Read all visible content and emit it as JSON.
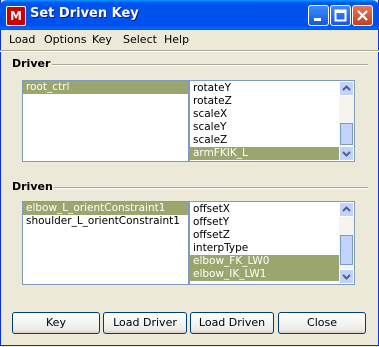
{
  "window": {
    "title": "Set Driven Key",
    "app_icon": "maya-icon"
  },
  "menu": [
    "Load",
    "Options",
    "Key",
    "Select",
    "Help"
  ],
  "driver": {
    "label": "Driver",
    "objects": [
      {
        "label": "root_ctrl",
        "selected": true
      }
    ],
    "attributes": [
      {
        "label": "rotateY",
        "selected": false
      },
      {
        "label": "rotateZ",
        "selected": false
      },
      {
        "label": "scaleX",
        "selected": false
      },
      {
        "label": "scaleY",
        "selected": false
      },
      {
        "label": "scaleZ",
        "selected": false
      },
      {
        "label": "armFKIK_L",
        "selected": true
      }
    ]
  },
  "driven": {
    "label": "Driven",
    "objects": [
      {
        "label": "elbow_L_orientConstraint1",
        "selected": true
      },
      {
        "label": "shoulder_L_orientConstraint1",
        "selected": false
      }
    ],
    "attributes": [
      {
        "label": "offsetX",
        "selected": false
      },
      {
        "label": "offsetY",
        "selected": false
      },
      {
        "label": "offsetZ",
        "selected": false
      },
      {
        "label": "interpType",
        "selected": false
      },
      {
        "label": "elbow_FK_LW0",
        "selected": true
      },
      {
        "label": "elbow_IK_LW1",
        "selected": true
      }
    ]
  },
  "buttons": {
    "key": "Key",
    "load_driver": "Load Driver",
    "load_driven": "Load Driven",
    "close": "Close"
  },
  "colors": {
    "selection": "#9aa66e",
    "titlebar": "#0050ee"
  }
}
